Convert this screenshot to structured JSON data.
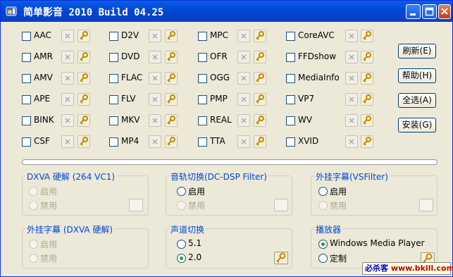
{
  "window": {
    "title": "简单影音 2010 Build 04.25",
    "controls": [
      "minimize-icon",
      "maximize-icon",
      "close-icon"
    ]
  },
  "codecs": [
    [
      "AAC",
      "AMR",
      "AMV",
      "APE",
      "BINK",
      "CSF"
    ],
    [
      "D2V",
      "DVD",
      "FLAC",
      "FLV",
      "MKV",
      "MP4"
    ],
    [
      "MPC",
      "OFR",
      "OGG",
      "PMP",
      "REAL",
      "TTA"
    ],
    [
      "CoreAVC",
      "FFDshow",
      "MediaInfo",
      "VP7",
      "WV",
      "XVID"
    ]
  ],
  "side_buttons": [
    "刷新(E)",
    "帮助(H)",
    "全选(A)",
    "安装(G)"
  ],
  "groups": {
    "dxva_hw": {
      "title": "DXVA 硬解 (264 VC1)",
      "options": [
        "启用",
        "禁用"
      ]
    },
    "audio_switch": {
      "title": "音轨切换(DC-DSP Filter)",
      "options": [
        "启用",
        "禁用"
      ]
    },
    "ext_sub_vs": {
      "title": "外挂字幕(VSFilter)",
      "options": [
        "启用",
        "禁用"
      ]
    },
    "ext_sub_dxva": {
      "title": "外挂字幕 (DXVA 硬解)",
      "options": [
        "启用",
        "禁用"
      ]
    },
    "channel_switch": {
      "title": "声道切换",
      "options": [
        "5.1",
        "2.0"
      ],
      "selected": "2.0"
    },
    "player": {
      "title": "播放器",
      "options": [
        "Windows Media Player",
        "定制"
      ],
      "selected": "Windows Media Player"
    }
  },
  "watermark": {
    "site": "www.bkill.com",
    "name": "必杀客"
  },
  "colors": {
    "titlebar": "#0047d6",
    "group_title": "#0046d5",
    "face": "#ece9d8"
  }
}
